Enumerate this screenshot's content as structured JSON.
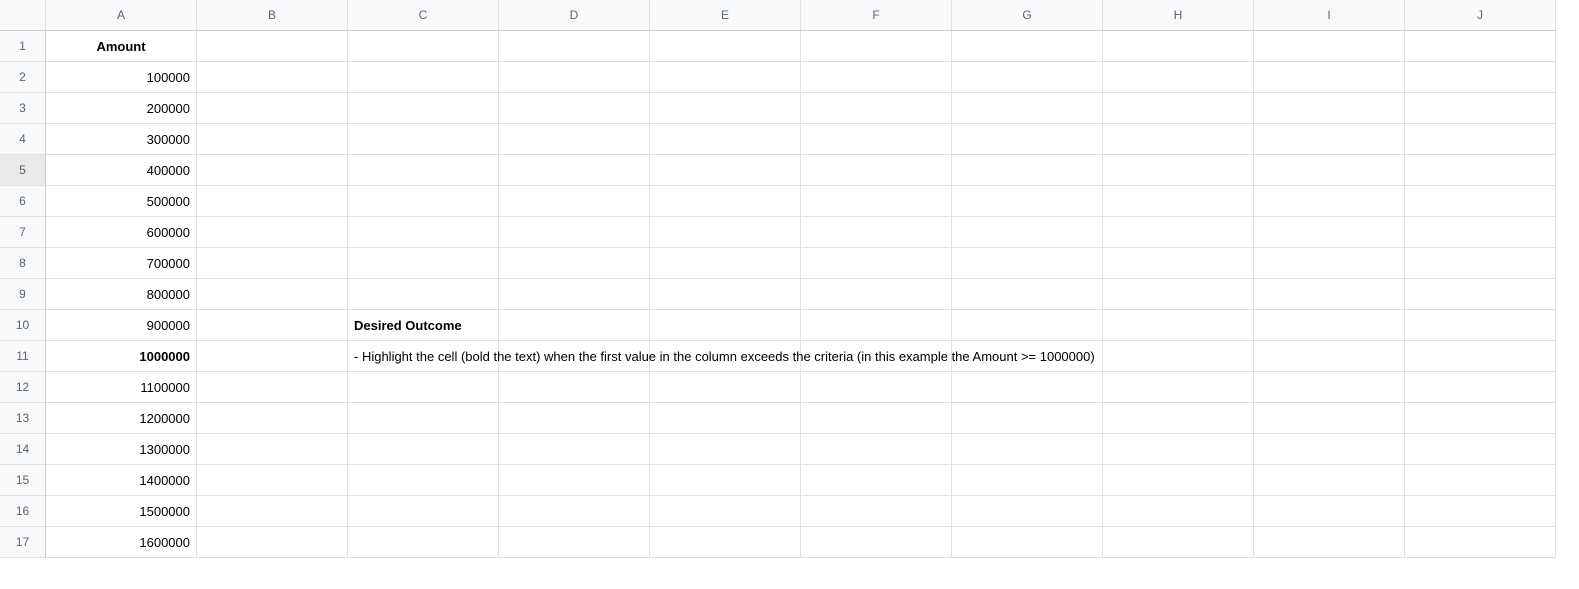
{
  "columns": [
    "A",
    "B",
    "C",
    "D",
    "E",
    "F",
    "G",
    "H",
    "I",
    "J"
  ],
  "rows": [
    "1",
    "2",
    "3",
    "4",
    "5",
    "6",
    "7",
    "8",
    "9",
    "10",
    "11",
    "12",
    "13",
    "14",
    "15",
    "16",
    "17"
  ],
  "selected_row_index": 4,
  "cells": {
    "A1": {
      "v": "Amount",
      "bold": true,
      "align": "center"
    },
    "A2": {
      "v": "100000",
      "align": "right"
    },
    "A3": {
      "v": "200000",
      "align": "right"
    },
    "A4": {
      "v": "300000",
      "align": "right"
    },
    "A5": {
      "v": "400000",
      "align": "right"
    },
    "A6": {
      "v": "500000",
      "align": "right"
    },
    "A7": {
      "v": "600000",
      "align": "right"
    },
    "A8": {
      "v": "700000",
      "align": "right"
    },
    "A9": {
      "v": "800000",
      "align": "right"
    },
    "A10": {
      "v": "900000",
      "align": "right"
    },
    "A11": {
      "v": "1000000",
      "bold": true,
      "align": "right"
    },
    "A12": {
      "v": "1100000",
      "align": "right"
    },
    "A13": {
      "v": "1200000",
      "align": "right"
    },
    "A14": {
      "v": "1300000",
      "align": "right"
    },
    "A15": {
      "v": "1400000",
      "align": "right"
    },
    "A16": {
      "v": "1500000",
      "align": "right"
    },
    "A17": {
      "v": "1600000",
      "align": "right"
    },
    "C10": {
      "v": "Desired Outcome",
      "bold": true,
      "align": "left",
      "overflow": true
    },
    "C11": {
      "v": " - Highlight the cell (bold the text) when the first value in the column exceeds the criteria (in this example the Amount >= 1000000)",
      "align": "left",
      "overflow": true
    }
  }
}
